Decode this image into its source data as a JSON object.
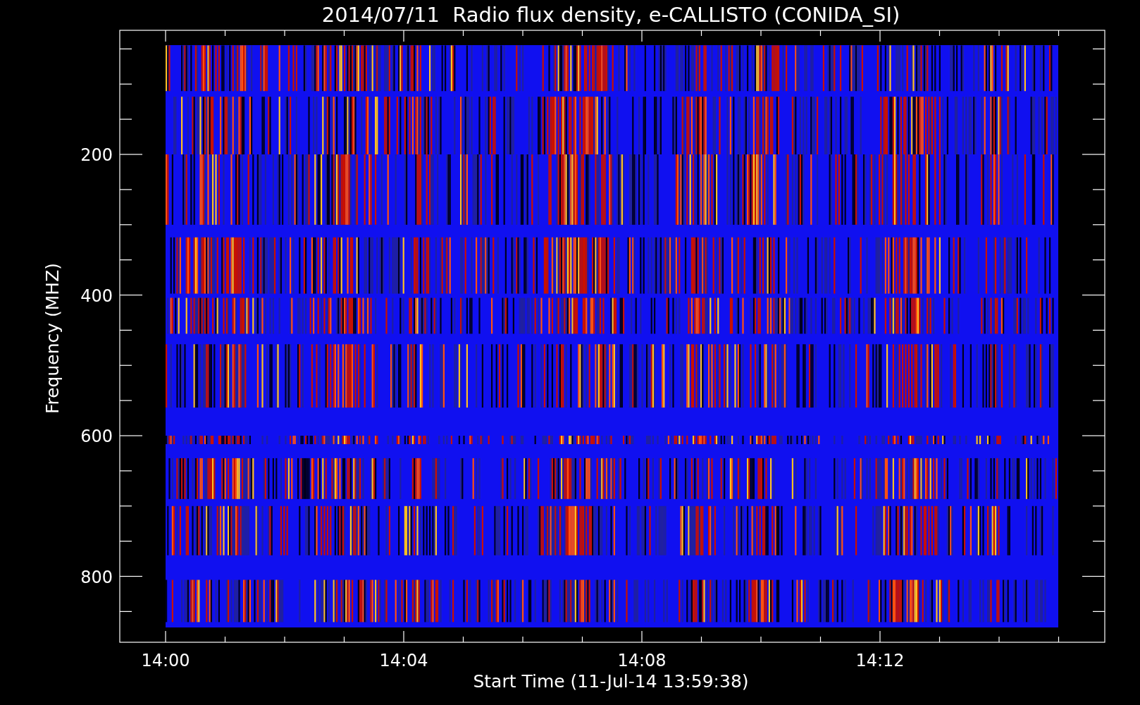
{
  "plot": {
    "title": "2014/07/11  Radio flux density, e-CALLISTO (CONIDA_SI)",
    "x_axis": {
      "label": "Start Time (11-Jul-14 13:59:38)",
      "ticks": [
        "14:00",
        "14:04",
        "14:08",
        "14:12"
      ]
    },
    "y_axis": {
      "label": "Frequency (MHZ)",
      "ticks": [
        "200",
        "400",
        "600",
        "800"
      ]
    }
  }
}
